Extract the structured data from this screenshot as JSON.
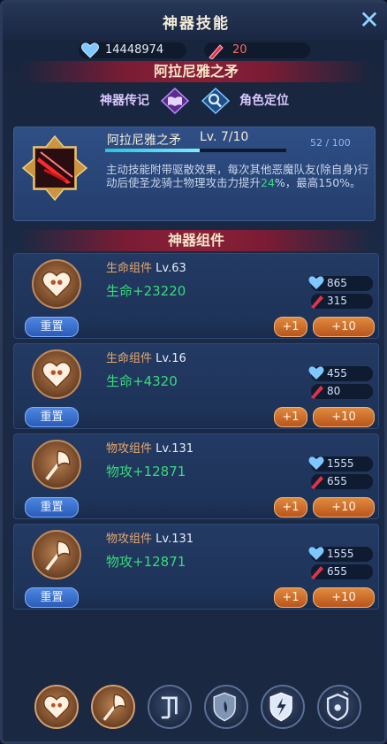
{
  "header": {
    "title": "神器技能",
    "close_icon": "close-icon"
  },
  "resources": {
    "gems": "14448974",
    "tickets": "20"
  },
  "artifact_banner": "阿拉尼雅之矛",
  "tabs": [
    {
      "label": "神器传记",
      "icon": "book-icon"
    },
    {
      "label": "角色定位",
      "icon": "magnifier-icon"
    }
  ],
  "artifact": {
    "name": "阿拉尼雅之矛",
    "level": "Lv. 7/10",
    "progress_text": "52 / 100",
    "progress_fraction": 0.52,
    "desc_a": "主动技能附带驱散效果，每次其他恶魔队友(除自身)行动后使圣龙骑士物理攻击力提升",
    "desc_hl": "24",
    "desc_b": "%，最高150%。"
  },
  "components_banner": "神器组件",
  "components": [
    {
      "name": "生命组件",
      "level": "Lv.63",
      "stat": "生命+23220",
      "cost_gems": "865",
      "cost_tix": "315",
      "reset": "重置",
      "plus1": "+1",
      "plus10": "+10",
      "icon": "heart-icon"
    },
    {
      "name": "生命组件",
      "level": "Lv.16",
      "stat": "生命+4320",
      "cost_gems": "455",
      "cost_tix": "80",
      "reset": "重置",
      "plus1": "+1",
      "plus10": "+10",
      "icon": "heart-icon"
    },
    {
      "name": "物攻组件",
      "level": "Lv.131",
      "stat": "物攻+12871",
      "cost_gems": "1555",
      "cost_tix": "655",
      "reset": "重置",
      "plus1": "+1",
      "plus10": "+10",
      "icon": "axe-icon"
    },
    {
      "name": "物攻组件",
      "level": "Lv.131",
      "stat": "物攻+12871",
      "cost_gems": "1555",
      "cost_tix": "655",
      "reset": "重置",
      "plus1": "+1",
      "plus10": "+10",
      "icon": "axe-icon"
    }
  ],
  "bottom_icons": [
    "heart-icon",
    "axe-icon",
    "rune-icon",
    "fire-shield-icon",
    "lightning-shield-icon",
    "shield-target-icon"
  ],
  "colors": {
    "accent_green": "#39d97a",
    "accent_orange": "#e08a3e",
    "accent_blue": "#4d86e0",
    "banner_red": "#7a1c34"
  }
}
